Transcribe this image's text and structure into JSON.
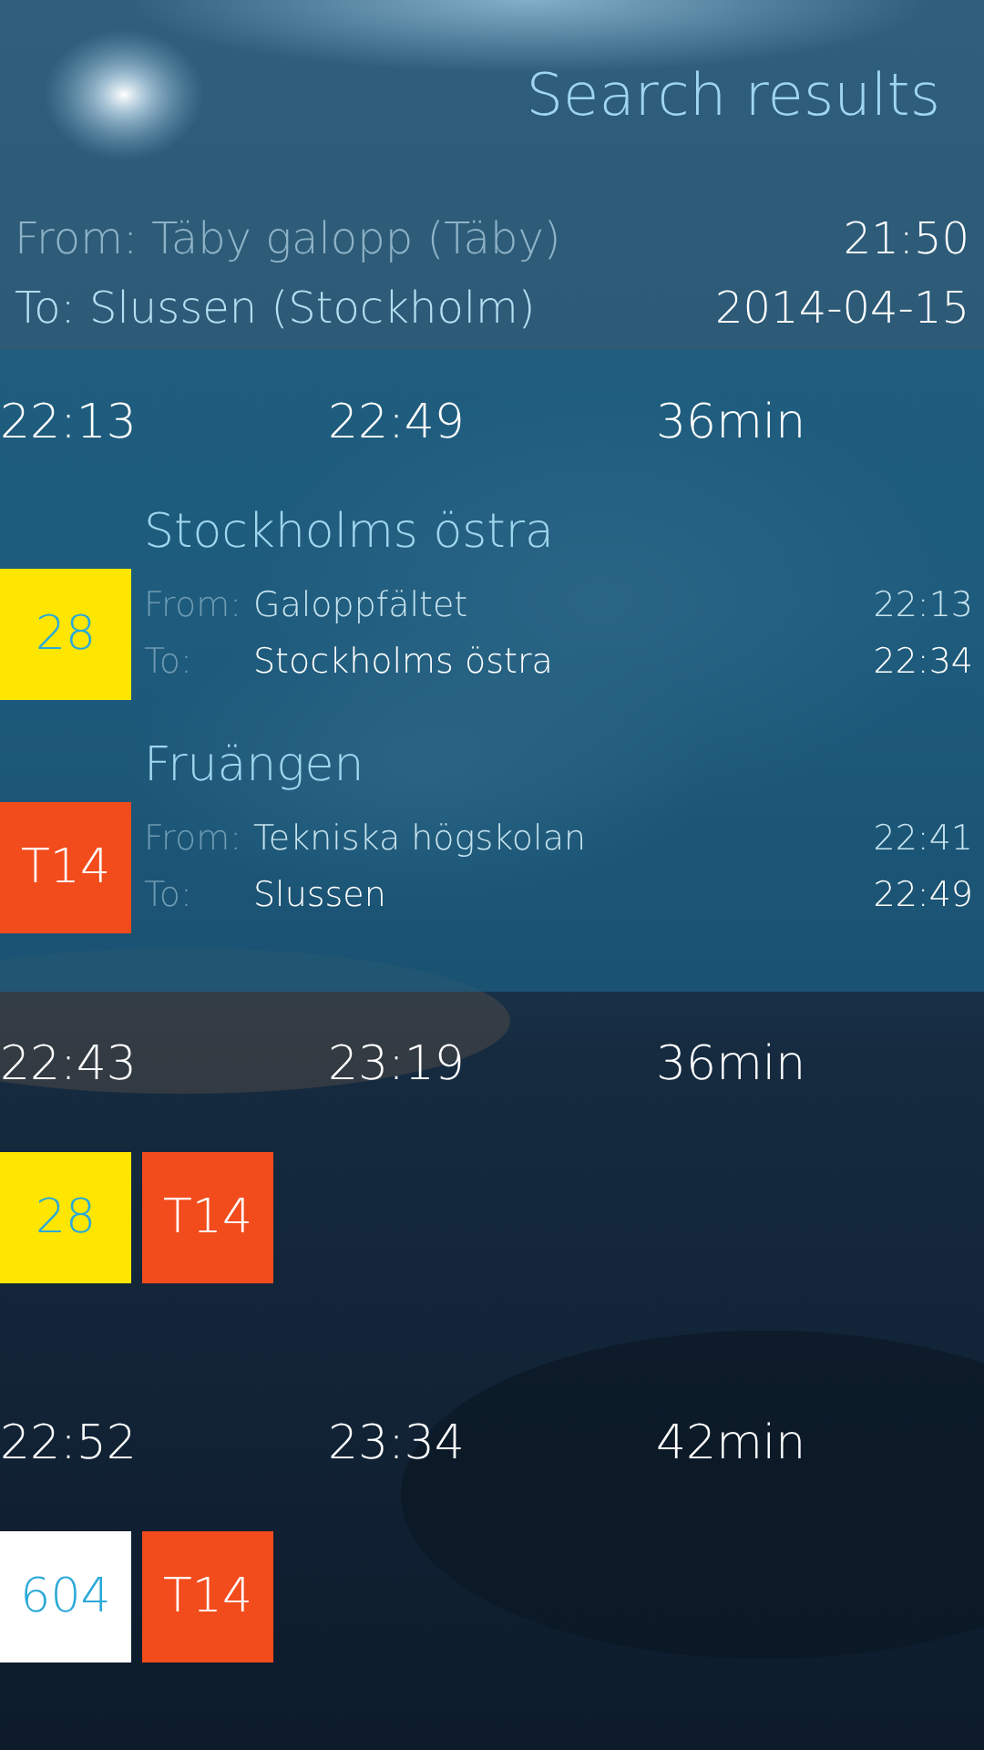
{
  "header": {
    "title": "Search results"
  },
  "query": {
    "from": "From: Täby galopp (Täby)",
    "time": "21:50",
    "to": "To: Slussen (Stockholm)",
    "date": "2014-04-15"
  },
  "trips": [
    {
      "depart": "22:13",
      "arrive": "22:49",
      "duration": "36min",
      "expanded": true,
      "legs": [
        {
          "line": "28",
          "color": "#ffe600",
          "destination": "Stockholms östra",
          "from_label": "From:",
          "from": "Galoppfältet",
          "from_time": "22:13",
          "to_label": "To:",
          "to": "Stockholms östra",
          "to_time": "22:34"
        },
        {
          "line": "T14",
          "color": "#f24b1c",
          "destination": "Fruängen",
          "from_label": "From:",
          "from": "Tekniska högskolan",
          "from_time": "22:41",
          "to_label": "To:",
          "to": "Slussen",
          "to_time": "22:49"
        }
      ]
    },
    {
      "depart": "22:43",
      "arrive": "23:19",
      "duration": "36min",
      "expanded": false,
      "legs": [
        {
          "line": "28",
          "color": "#ffe600"
        },
        {
          "line": "T14",
          "color": "#f24b1c"
        }
      ]
    },
    {
      "depart": "22:52",
      "arrive": "23:34",
      "duration": "42min",
      "expanded": false,
      "legs": [
        {
          "line": "604",
          "color": "#ffffff"
        },
        {
          "line": "T14",
          "color": "#f24b1c"
        }
      ]
    }
  ]
}
